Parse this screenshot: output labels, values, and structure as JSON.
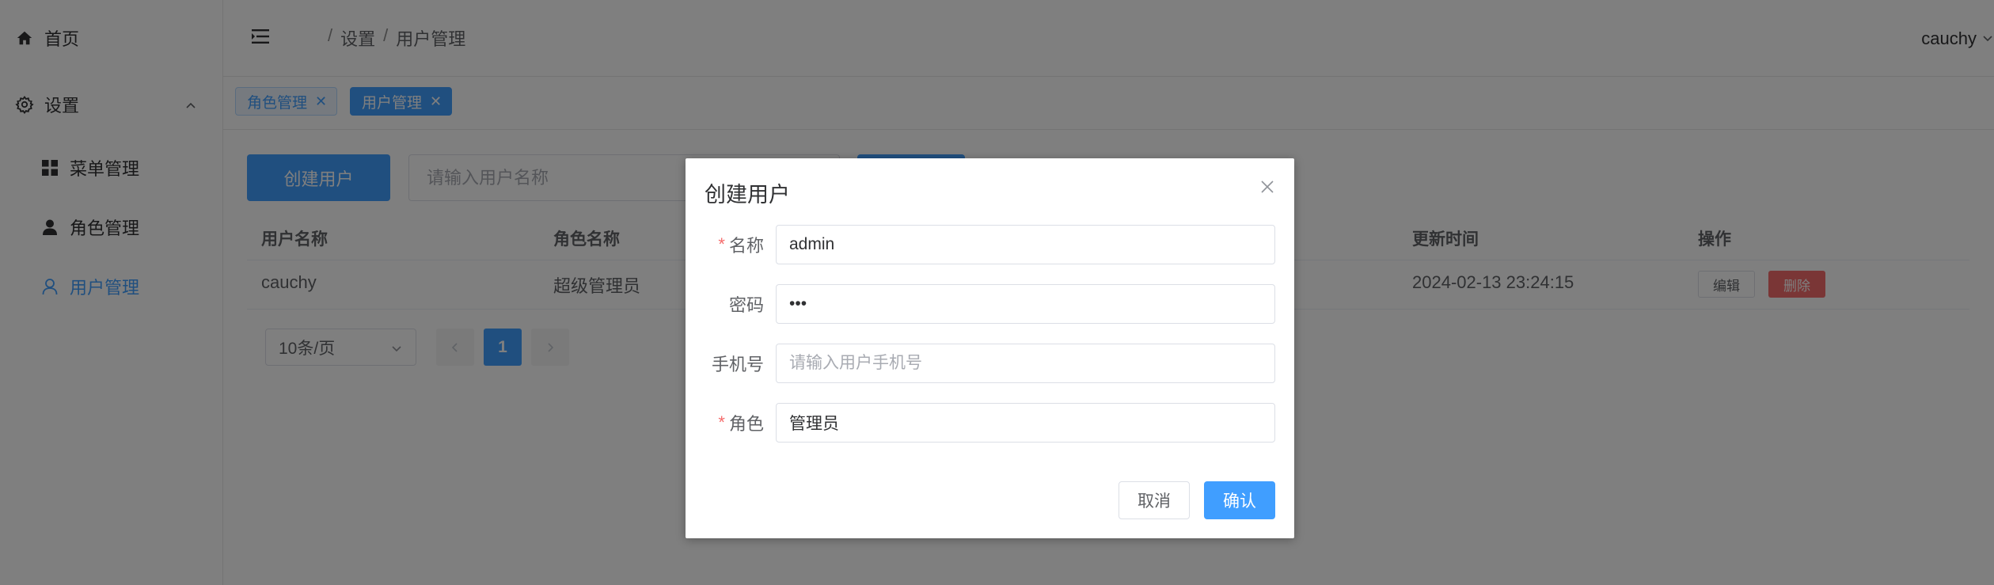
{
  "sidebar": {
    "home_label": "首页",
    "settings_label": "设置",
    "items": [
      {
        "label": "菜单管理",
        "icon": "grid-icon"
      },
      {
        "label": "角色管理",
        "icon": "person-icon"
      },
      {
        "label": "用户管理",
        "icon": "user-outline-icon",
        "active": true
      }
    ]
  },
  "header": {
    "breadcrumb": [
      "设置",
      "用户管理"
    ],
    "breadcrumb_separator": "/",
    "username": "cauchy"
  },
  "tags": [
    {
      "label": "角色管理",
      "active": false
    },
    {
      "label": "用户管理",
      "active": true
    }
  ],
  "toolbar": {
    "create_label": "创建用户",
    "search_placeholder": "请输入用户名称"
  },
  "table": {
    "columns": [
      "用户名称",
      "角色名称",
      "更新时间",
      "操作"
    ],
    "rows": [
      {
        "username": "cauchy",
        "role": "超级管理员",
        "updated": "2024-02-13 23:24:15"
      }
    ],
    "edit_label": "编辑",
    "delete_label": "删除"
  },
  "pagination": {
    "page_size": "10条/页",
    "current_page": "1"
  },
  "dialog": {
    "title": "创建用户",
    "fields": {
      "name_label": "名称",
      "name_value": "admin",
      "password_label": "密码",
      "password_value": "•••",
      "phone_label": "手机号",
      "phone_placeholder": "请输入用户手机号",
      "role_label": "角色",
      "role_value": "管理员"
    },
    "required_mark": "*",
    "cancel_label": "取消",
    "confirm_label": "确认"
  },
  "colors": {
    "primary": "#409eff",
    "danger": "#f56c6c",
    "overlay": "rgba(0,0,0,0.5)"
  }
}
